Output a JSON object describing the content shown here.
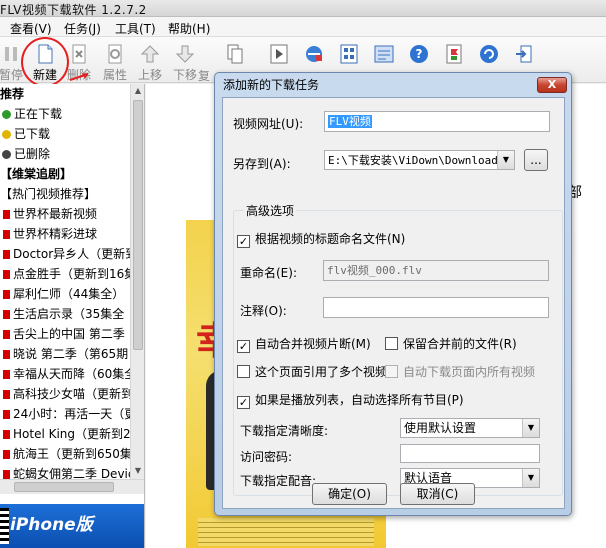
{
  "window": {
    "title": "FLV视频下载软件 1.2.7.2"
  },
  "menu": [
    {
      "label": "查看(V)"
    },
    {
      "label": "任务(J)"
    },
    {
      "label": "工具(T)"
    },
    {
      "label": "帮助(H)"
    }
  ],
  "toolbar": {
    "pause_label": "暂停",
    "new_label": "新建",
    "delete_label": "删除",
    "properties_label": "属性",
    "move_up_label": "上移",
    "move_down_label": "下移",
    "extra_label": "复"
  },
  "sidebar": {
    "section_title": "推荐",
    "items": [
      {
        "label": "正在下载",
        "icon": "downloading-icon",
        "color": "#2e9a2e"
      },
      {
        "label": "已下载",
        "icon": "downloaded-icon",
        "color": "#e0b400"
      },
      {
        "label": "已删除",
        "icon": "deleted-icon",
        "color": "#444444"
      },
      {
        "label": "【维棠追剧】",
        "header": true
      },
      {
        "label": "【热门视频推荐】",
        "header": true
      },
      {
        "label": "世界杯最新视频"
      },
      {
        "label": "世界杯精彩进球"
      },
      {
        "label": "Doctor异乡人（更新到"
      },
      {
        "label": "点金胜手（更新到16集"
      },
      {
        "label": "犀利仁师（44集全）"
      },
      {
        "label": "生活启示录（35集全"
      },
      {
        "label": "舌尖上的中国 第二季"
      },
      {
        "label": "晓说 第二季（第65期"
      },
      {
        "label": "幸福从天而降（60集全"
      },
      {
        "label": "高科技少女喵（更新到"
      },
      {
        "label": "24小时：再活一天（更"
      },
      {
        "label": "Hotel King（更新到2"
      },
      {
        "label": "航海王（更新到650集"
      },
      {
        "label": "蛇蝎女佣第二季 Devic"
      }
    ],
    "banner_text": "iPhone版"
  },
  "background": {
    "big_char": "剧",
    "side_text": "部",
    "poster_title": "幸"
  },
  "dialog": {
    "title": "添加新的下载任务",
    "close_label": "X",
    "url_label": "视频网址(U):",
    "url_value": "FLV视频",
    "save_label": "另存到(A):",
    "save_value": "E:\\下载安装\\ViDown\\Download\\",
    "browse_label": "...",
    "advanced_title": "高级选项",
    "rename_by_title": {
      "label": "根据视频的标题命名文件(N)",
      "checked": true
    },
    "rename_label": "重命名(E):",
    "rename_value": "flv视频_000.flv",
    "note_label": "注释(O):",
    "note_value": "",
    "auto_merge": {
      "label": "自动合并视频片断(M)",
      "checked": true
    },
    "keep_before_merge": {
      "label": "保留合并前的文件(R)",
      "checked": false
    },
    "multi_video": {
      "label": "这个页面引用了多个视频",
      "checked": false
    },
    "auto_download_all": {
      "label": "自动下载页面内所有视频",
      "checked": false,
      "disabled": true
    },
    "playlist_auto": {
      "label": "如果是播放列表，自动选择所有节目(P)",
      "checked": true
    },
    "quality_label": "下载指定清晰度:",
    "quality_value": "使用默认设置",
    "password_label": "访问密码:",
    "password_value": "",
    "audio_label": "下载指定配音:",
    "audio_value": "默认语音",
    "ok_label": "确定(O)",
    "cancel_label": "取消(C)"
  }
}
